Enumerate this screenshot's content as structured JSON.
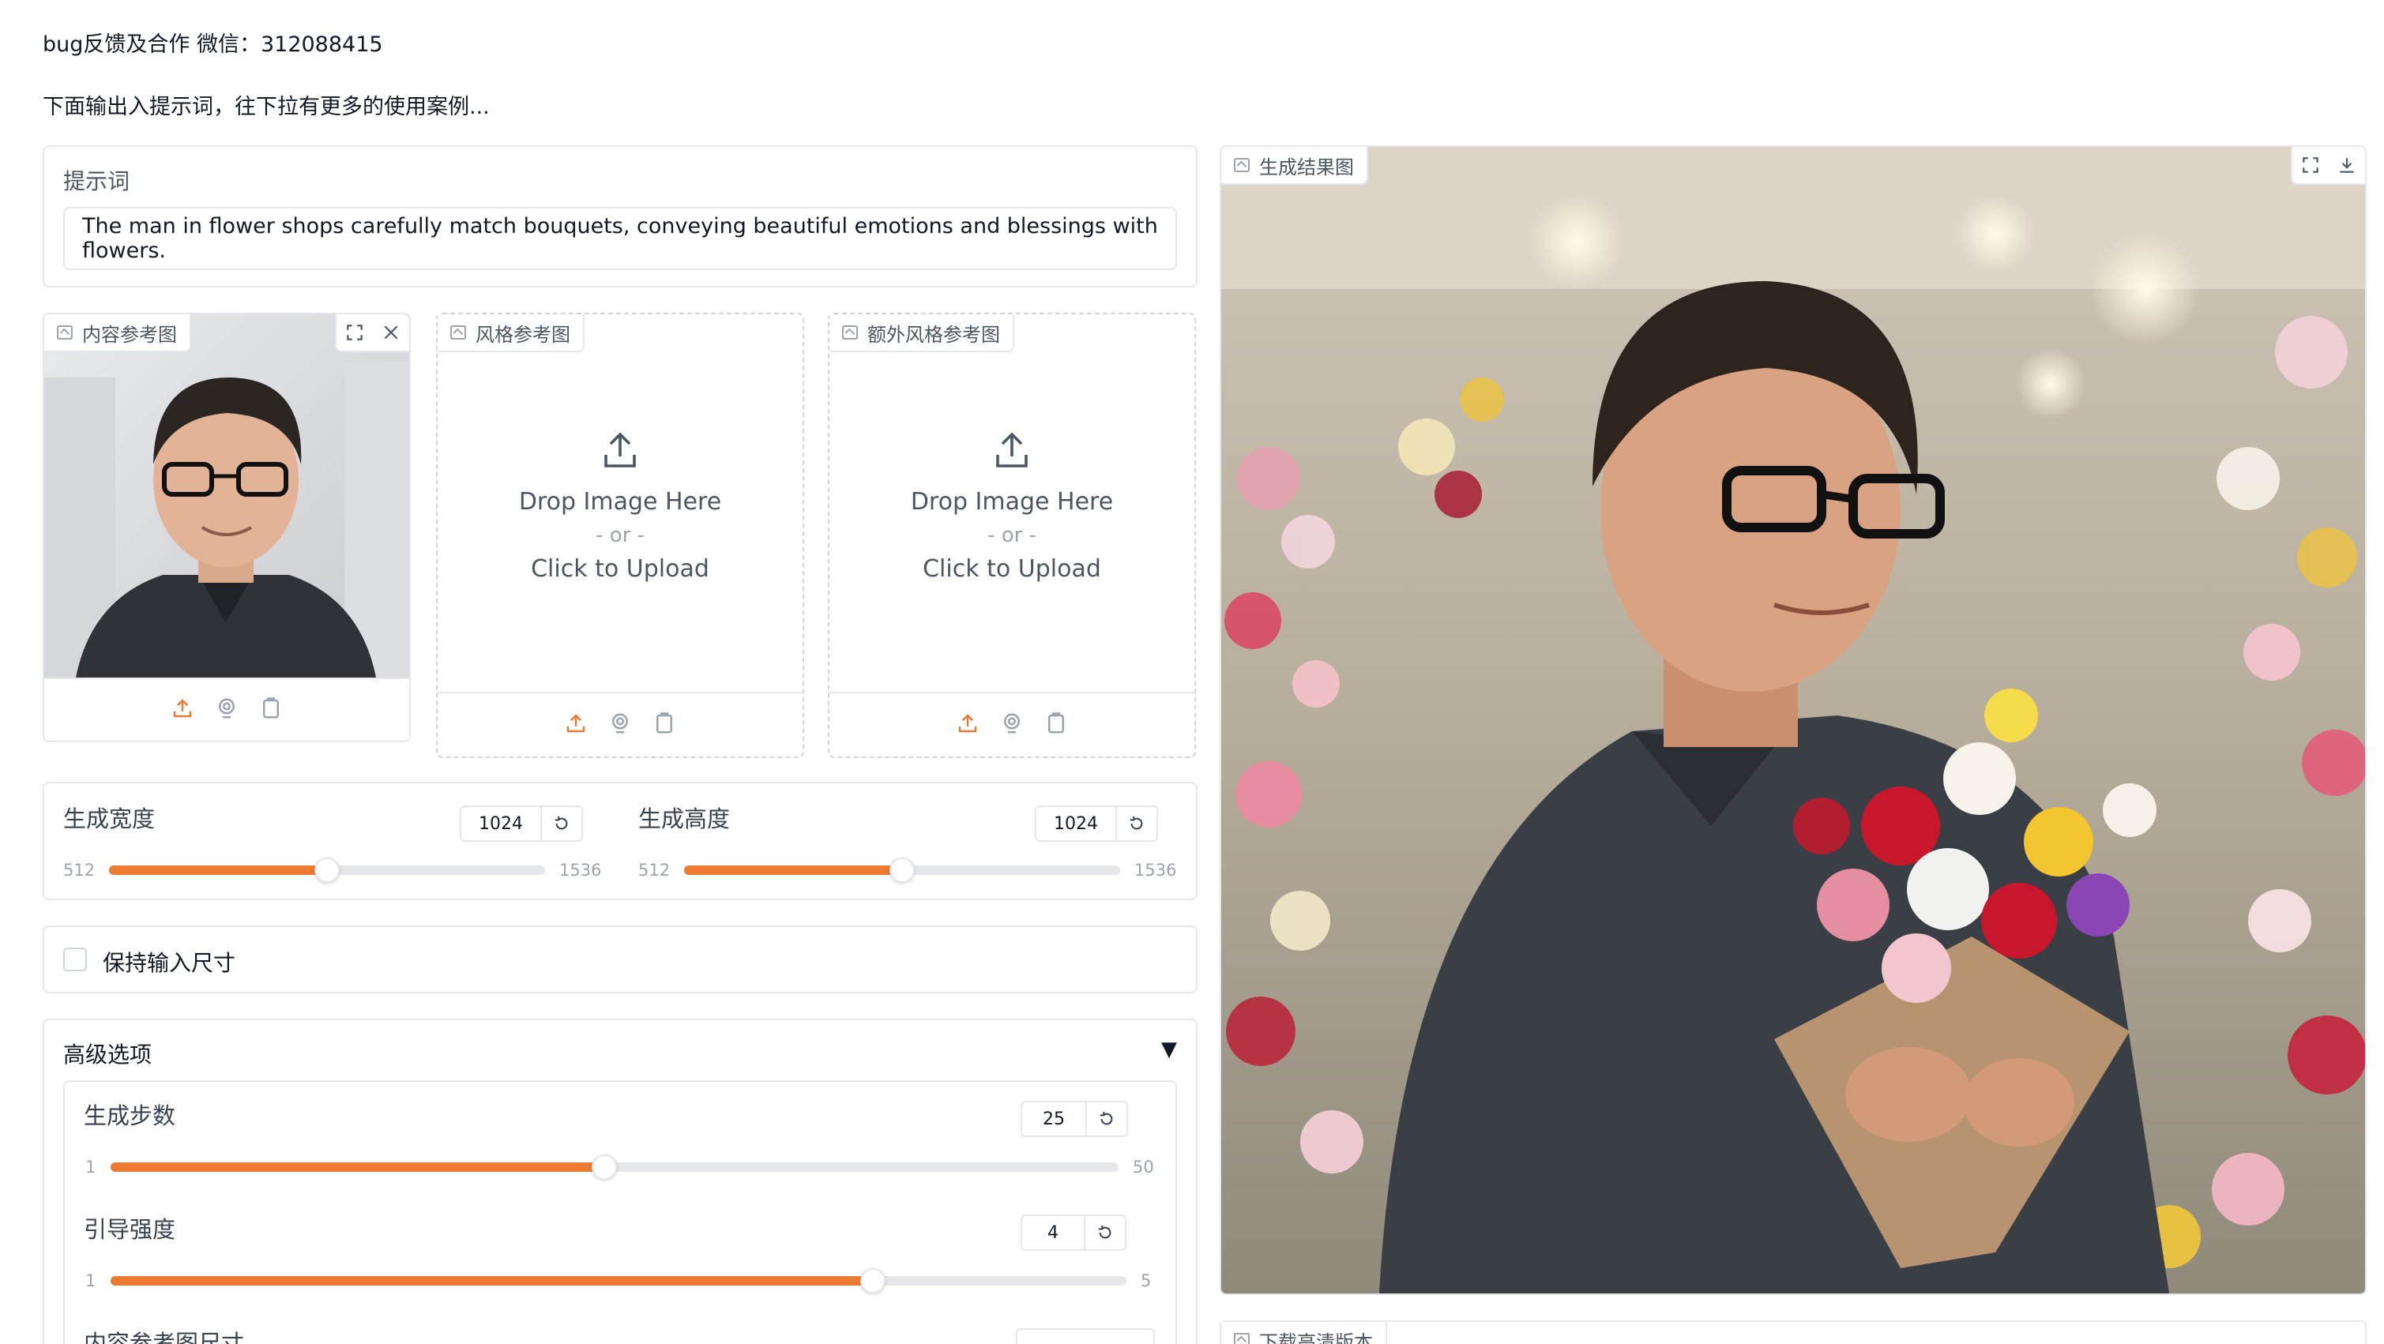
{
  "header": {
    "contact": "bug反馈及合作 微信：312088415",
    "intro": "下面输出入提示词，往下拉有更多的使用案例..."
  },
  "prompt": {
    "label": "提示词",
    "value": "The man in flower shops carefully match bouquets, conveying beautiful emotions and blessings with flowers."
  },
  "content_ref": {
    "label": "内容参考图",
    "image_desc": "portrait"
  },
  "style_ref": {
    "label": "风格参考图",
    "drop": "Drop Image Here",
    "or": "- or -",
    "click": "Click to Upload"
  },
  "extra_style_ref": {
    "label": "额外风格参考图",
    "drop": "Drop Image Here",
    "or": "- or -",
    "click": "Click to Upload"
  },
  "width_slider": {
    "label": "生成宽度",
    "value": "1024",
    "min": "512",
    "max": "1536",
    "fraction": 0.5
  },
  "height_slider": {
    "label": "生成高度",
    "value": "1024",
    "min": "512",
    "max": "1536",
    "fraction": 0.5
  },
  "keep_size": {
    "label": "保持输入尺寸",
    "checked": false
  },
  "advanced": {
    "title": "高级选项",
    "toggle": "▼",
    "steps": {
      "label": "生成步数",
      "value": "25",
      "min": "1",
      "max": "50",
      "fraction": 0.49
    },
    "guidance": {
      "label": "引导强度",
      "value": "4",
      "min": "1",
      "max": "5",
      "fraction": 0.75
    },
    "ref_size": {
      "label": "内容参考图尺寸"
    }
  },
  "result": {
    "label": "生成结果图"
  },
  "download": {
    "label": "下载高清版本"
  },
  "colors": {
    "accent": "#ec7a33",
    "border": "#e5e7eb"
  },
  "icons": [
    "image-icon",
    "upload-icon",
    "webcam-icon",
    "clipboard-icon",
    "fullscreen-icon",
    "close-icon",
    "download-icon",
    "reset-icon"
  ]
}
